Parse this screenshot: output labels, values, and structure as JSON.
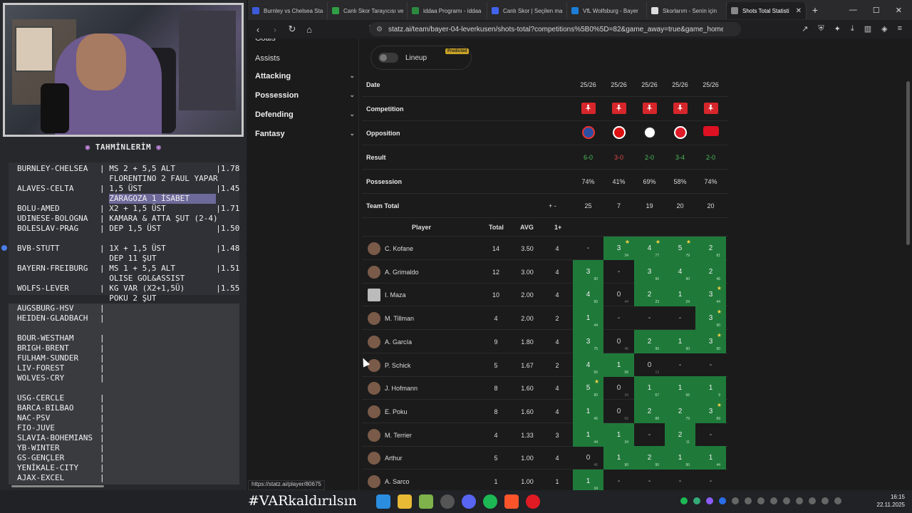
{
  "overlay": {
    "title": "TAHMİNLERİM",
    "bets": [
      {
        "match": "BURNLEY-CHELSEA",
        "pick": "MS 2 + 5,5 ALT",
        "odd": "1.78"
      },
      {
        "match": "",
        "pick": "FLORENTINO 2 FAUL YAPAR",
        "odd": ""
      },
      {
        "match": "ALAVES-CELTA",
        "pick": "1,5 ÜST",
        "odd": "1.45"
      },
      {
        "match": "",
        "pick": "ZARAGOZA 1 İSABET",
        "odd": ""
      },
      {
        "match": "BOLU-AMED",
        "pick": "X2 + 1,5 ÜST",
        "odd": "1.71"
      },
      {
        "match": "UDINESE-BOLOGNA",
        "pick": "KAMARA & ATTA ŞUT (2-4)",
        "odd": ""
      },
      {
        "match": "BOLESLAV-PRAG",
        "pick": "DEP 1,5 ÜST",
        "odd": "1.50"
      },
      {
        "match": "BVB-STUTT",
        "pick": "1X + 1,5 ÜST",
        "odd": "1.48"
      },
      {
        "match": "",
        "pick": "DEP 11 ŞUT",
        "odd": ""
      },
      {
        "match": "BAYERN-FREIBURG",
        "pick": "MS 1 + 5,5 ALT",
        "odd": "1.51"
      },
      {
        "match": "",
        "pick": "OLISE GOL&ASSIST",
        "odd": ""
      },
      {
        "match": "WOLFS-LEVER",
        "pick": "KG VAR (X2+1,5Ü)",
        "odd": "1.55"
      },
      {
        "match": "",
        "pick": "POKU 2 ŞUT",
        "odd": ""
      }
    ],
    "fixtures": [
      "AUGSBURG-HSV",
      "HEIDEN-GLADBACH",
      "",
      "BOUR-WESTHAM",
      "BRIGH-BRENT",
      "FULHAM-SUNDER",
      "LIV-FOREST",
      "WOLVES-CRY",
      "",
      "USG-CERCLE",
      "BARCA-BILBAO",
      "NAC-PSV",
      "FIO-JUVE",
      "SLAVIA-BOHEMIANS",
      "YB-WINTER",
      "GS-GENÇLER",
      "YENİKALE-CITY",
      "AJAX-EXCEL"
    ]
  },
  "browser": {
    "tabs": [
      {
        "label": "Burnley vs Chelsea Sta",
        "color": "#3b5bdb"
      },
      {
        "label": "Canlı Skor Tarayıcısı ve",
        "color": "#2f9e44"
      },
      {
        "label": "iddaa Programı - iddaa",
        "color": "#2b8a3e"
      },
      {
        "label": "Canlı Skor | Seçilen ma",
        "color": "#4263eb"
      },
      {
        "label": "VfL Wolfsburg - Bayer",
        "color": "#1c7ed6"
      },
      {
        "label": "Skorlarım - Senin için",
        "color": "#ddd"
      },
      {
        "label": "Shots Total Statisti",
        "color": "#888",
        "active": true
      }
    ],
    "url": "statz.ai/team/bayer-04-leverkusen/shots-total?competitions%5B0%5D=82&game_away=true&game_home=true...",
    "status_url": "https://statz.ai/player/80675"
  },
  "sidebar": {
    "items": [
      {
        "label": "Goals",
        "chevron": false
      },
      {
        "label": "Assists",
        "chevron": false
      },
      {
        "label": "Attacking",
        "chevron": true
      },
      {
        "label": "Possession",
        "chevron": true
      },
      {
        "label": "Defending",
        "chevron": true
      },
      {
        "label": "Fantasy",
        "chevron": true
      }
    ]
  },
  "lineup": {
    "label": "Lineup",
    "badge": "Predicted"
  },
  "header_rows": {
    "date_label": "Date",
    "dates": [
      "25/26",
      "25/26",
      "25/26",
      "25/26",
      "25/26"
    ],
    "competition_label": "Competition",
    "opposition_label": "Opposition",
    "result_label": "Result",
    "results": [
      {
        "score": "6-0",
        "status": "win"
      },
      {
        "score": "3-0",
        "status": "loss"
      },
      {
        "score": "2-0",
        "status": "win"
      },
      {
        "score": "3-4",
        "status": "win"
      },
      {
        "score": "2-0",
        "status": "win"
      }
    ],
    "possession_label": "Possession",
    "possession": [
      "74%",
      "41%",
      "69%",
      "58%",
      "74%"
    ],
    "team_total_label": "Team Total",
    "team_totals": [
      "25",
      "7",
      "19",
      "20",
      "20"
    ]
  },
  "columns": {
    "player": "Player",
    "total": "Total",
    "avg": "AVG",
    "one_plus": "1+"
  },
  "players": [
    {
      "name": "C. Kofane",
      "total": "14",
      "avg": "3.50",
      "one": "4",
      "games": [
        [
          "-",
          "",
          false,
          false
        ],
        [
          "3",
          "34",
          true,
          true
        ],
        [
          "4",
          "77",
          true,
          true
        ],
        [
          "5",
          "79",
          true,
          true
        ],
        [
          "2",
          "81",
          true,
          false
        ]
      ]
    },
    {
      "name": "A. Grimaldo",
      "total": "12",
      "avg": "3.00",
      "one": "4",
      "games": [
        [
          "3",
          "90",
          true,
          false
        ],
        [
          "-",
          "",
          false,
          false
        ],
        [
          "3",
          "90",
          true,
          false
        ],
        [
          "4",
          "90",
          true,
          false
        ],
        [
          "2",
          "46",
          true,
          false
        ]
      ]
    },
    {
      "name": "I. Maza",
      "total": "10",
      "avg": "2.00",
      "one": "4",
      "games": [
        [
          "4",
          "90",
          true,
          false
        ],
        [
          "0",
          "44",
          false,
          false
        ],
        [
          "2",
          "23",
          true,
          false
        ],
        [
          "1",
          "24",
          true,
          false
        ],
        [
          "3",
          "44",
          true,
          true
        ]
      ]
    },
    {
      "name": "M. Tillman",
      "total": "4",
      "avg": "2.00",
      "one": "2",
      "games": [
        [
          "1",
          "44",
          true,
          false
        ],
        [
          "-",
          "",
          false,
          false
        ],
        [
          "-",
          "",
          false,
          false
        ],
        [
          "-",
          "",
          false,
          false
        ],
        [
          "3",
          "90",
          true,
          true
        ]
      ]
    },
    {
      "name": "A. García",
      "total": "9",
      "avg": "1.80",
      "one": "4",
      "games": [
        [
          "3",
          "75",
          true,
          false
        ],
        [
          "0",
          "46",
          false,
          false
        ],
        [
          "2",
          "90",
          true,
          false
        ],
        [
          "1",
          "90",
          true,
          false
        ],
        [
          "3",
          "90",
          true,
          true
        ]
      ]
    },
    {
      "name": "P. Schick",
      "total": "5",
      "avg": "1.67",
      "one": "2",
      "games": [
        [
          "4",
          "56",
          true,
          false
        ],
        [
          "1",
          "56",
          true,
          false
        ],
        [
          "0",
          "13",
          false,
          false
        ],
        [
          "-",
          "",
          false,
          false
        ],
        [
          "-",
          "",
          false,
          false
        ]
      ]
    },
    {
      "name": "J. Hofmann",
      "total": "8",
      "avg": "1.60",
      "one": "4",
      "games": [
        [
          "5",
          "90",
          true,
          true
        ],
        [
          "0",
          "34",
          false,
          false
        ],
        [
          "1",
          "67",
          true,
          false
        ],
        [
          "1",
          "66",
          true,
          false
        ],
        [
          "1",
          "9",
          true,
          false
        ]
      ]
    },
    {
      "name": "E. Poku",
      "total": "8",
      "avg": "1.60",
      "one": "4",
      "games": [
        [
          "1",
          "46",
          true,
          false
        ],
        [
          "0",
          "56",
          false,
          false
        ],
        [
          "2",
          "88",
          true,
          false
        ],
        [
          "2",
          "79",
          true,
          false
        ],
        [
          "3",
          "89",
          true,
          true
        ]
      ]
    },
    {
      "name": "M. Terrier",
      "total": "4",
      "avg": "1.33",
      "one": "3",
      "games": [
        [
          "1",
          "44",
          true,
          false
        ],
        [
          "1",
          "34",
          true,
          false
        ],
        [
          "-",
          "",
          false,
          false
        ],
        [
          "2",
          "11",
          true,
          false
        ],
        [
          "-",
          "",
          false,
          false
        ]
      ]
    },
    {
      "name": "Arthur",
      "total": "5",
      "avg": "1.00",
      "one": "4",
      "games": [
        [
          "0",
          "46",
          false,
          false
        ],
        [
          "1",
          "90",
          true,
          false
        ],
        [
          "2",
          "90",
          true,
          false
        ],
        [
          "1",
          "90",
          true,
          false
        ],
        [
          "1",
          "44",
          true,
          false
        ]
      ]
    },
    {
      "name": "A. Sarco",
      "total": "1",
      "avg": "1.00",
      "one": "1",
      "games": [
        [
          "1",
          "34",
          true,
          false
        ],
        [
          "-",
          "",
          false,
          false
        ],
        [
          "-",
          "",
          false,
          false
        ],
        [
          "-",
          "",
          false,
          false
        ],
        [
          "-",
          "",
          false,
          false
        ]
      ]
    }
  ],
  "taskbar": {
    "hashtag": "#VARkaldırılsın",
    "time": "16:15",
    "date": "22.11.2025"
  },
  "colors": {
    "green_cell": "#1f7a3a",
    "win": "#4cbb5a",
    "loss": "#e04848",
    "star": "#f4d04a"
  }
}
